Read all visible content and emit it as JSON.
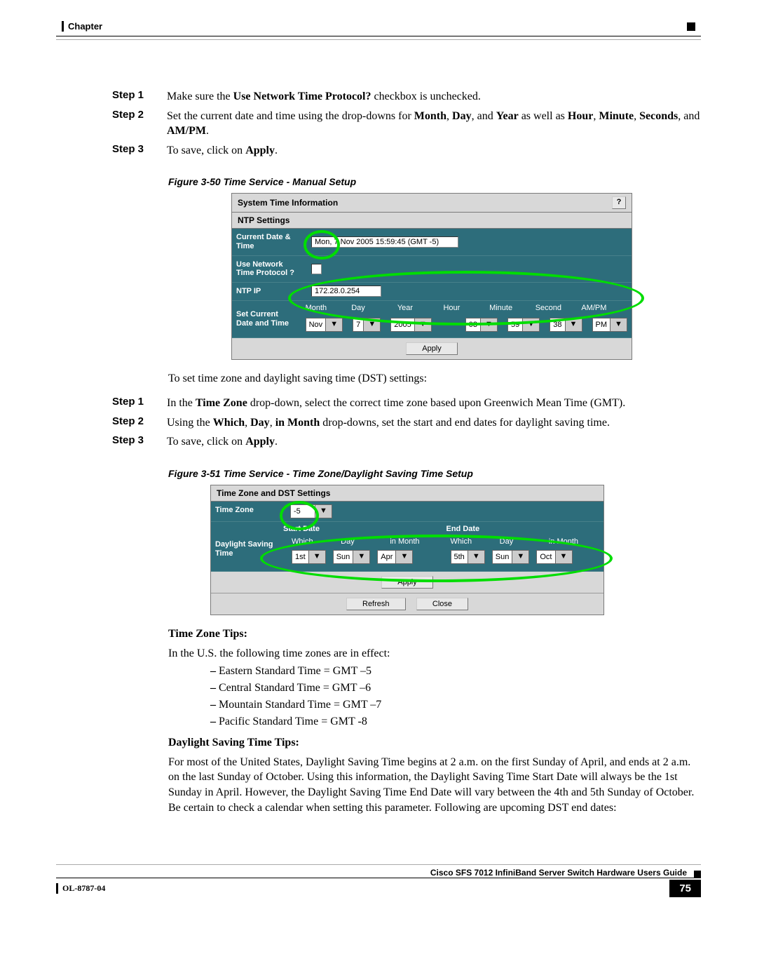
{
  "header": {
    "chapter": "Chapter"
  },
  "steps1": {
    "s1_label": "Step 1",
    "s1_a": "Make sure the ",
    "s1_b": "Use Network Time Protocol?",
    "s1_c": " checkbox is unchecked.",
    "s2_label": "Step 2",
    "s2_a": "Set the current date and time using the drop-downs for ",
    "s2_month": "Month",
    "s2_c1": ", ",
    "s2_day": "Day",
    "s2_c2": ", and ",
    "s2_year": "Year",
    "s2_mid": " as well as ",
    "s2_hour": "Hour",
    "s2_c3": ", ",
    "s2_minute": "Minute",
    "s2_c4": ", ",
    "s2_seconds": "Seconds",
    "s2_c5": ", and ",
    "s2_ampm": "AM/PM",
    "s2_end": ".",
    "s3_label": "Step 3",
    "s3_a": "To save, click on ",
    "s3_apply": "Apply",
    "s3_end": "."
  },
  "fig50": {
    "caption": "Figure 3-50   Time Service - Manual Setup",
    "title": "System Time Information",
    "help": "?",
    "ntp_settings": "NTP Settings",
    "lbl_current": "Current Date & Time",
    "val_current": "Mon, 7 Nov 2005 15:59:45 (GMT -5)",
    "lbl_usentp": "Use Network Time Protocol ?",
    "lbl_ntpip": "NTP IP",
    "val_ntpip": "172.28.0.254",
    "lbl_setdt": "Set Current Date and Time",
    "h_month": "Month",
    "h_day": "Day",
    "h_year": "Year",
    "h_hour": "Hour",
    "h_minute": "Minute",
    "h_second": "Second",
    "h_ampm": "AM/PM",
    "v_month": "Nov",
    "v_day": "7",
    "v_year": "2005",
    "v_hour": "03",
    "v_minute": "59",
    "v_second": "38",
    "v_ampm": "PM",
    "apply": "Apply"
  },
  "intro_dst": "To set time zone and daylight saving time (DST) settings:",
  "steps2": {
    "s1_label": "Step 1",
    "s1_a": "In the ",
    "s1_b": "Time Zone",
    "s1_c": " drop-down, select the correct time zone based upon Greenwich Mean Time (GMT).",
    "s2_label": "Step 2",
    "s2_a": "Using the ",
    "s2_which": "Which",
    "s2_c1": ", ",
    "s2_day": "Day",
    "s2_c2": ", ",
    "s2_in": "in Month",
    "s2_c3": " drop-downs, set the start and end dates for daylight saving time.",
    "s3_label": "Step 3",
    "s3_a": "To save, click on ",
    "s3_apply": "Apply",
    "s3_end": "."
  },
  "fig51": {
    "caption": "Figure 3-51   Time Service - Time Zone/Daylight Saving Time Setup",
    "title": "Time Zone and DST Settings",
    "lbl_tz": "Time Zone",
    "val_tz": "-5",
    "lbl_dst": "Daylight Saving Time",
    "start": "Start Date",
    "end": "End Date",
    "which": "Which",
    "day": "Day",
    "inmonth": "in Month",
    "s_which": "1st",
    "s_day": "Sun",
    "s_mon": "Apr",
    "e_which": "5th",
    "e_day": "Sun",
    "e_mon": "Oct",
    "apply": "Apply",
    "refresh": "Refresh",
    "close": "Close"
  },
  "tips": {
    "tz_title": "Time Zone Tips:",
    "tz_intro": "In the U.S. the following time zones are in effect:",
    "tz1": "Eastern Standard Time = GMT –5",
    "tz2": "Central Standard Time = GMT –6",
    "tz3": "Mountain Standard Time = GMT –7",
    "tz4": "Pacific Standard Time = GMT -8",
    "dst_title": "Daylight Saving Time Tips:",
    "dst_body": "For most of the United States, Daylight Saving Time begins at 2 a.m. on the first Sunday of April, and ends at 2 a.m. on the last Sunday of October. Using this information, the Daylight Saving Time Start Date will always be the 1st Sunday in April. However, the Daylight Saving Time End Date will vary between the 4th and 5th Sunday of October. Be certain to check a calendar when setting this parameter. Following are upcoming DST end dates:"
  },
  "footer": {
    "doc_title": "Cisco SFS 7012 InfiniBand Server Switch Hardware Users Guide",
    "doc_id": "OL-8787-04",
    "page": "75"
  }
}
